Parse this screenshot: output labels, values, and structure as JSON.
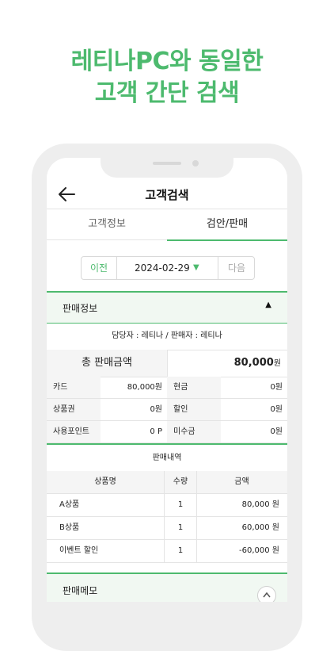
{
  "headline": {
    "line1": "레티나PC와 동일한",
    "line2": "고객 간단 검색"
  },
  "appbar": {
    "title": "고객검색"
  },
  "tabs": [
    {
      "label": "고객정보"
    },
    {
      "label": "검안/판매"
    }
  ],
  "date_nav": {
    "prev_label": "이전",
    "date": "2024-02-29",
    "next_label": "다음"
  },
  "sales_info": {
    "title": "판매정보",
    "toggle": "▲",
    "staff_line": "담당자 : 레티나 / 판매자 : 레티나",
    "total_label": "총 판매금액",
    "total_value": "80,000",
    "total_unit": "원",
    "rows": [
      {
        "k1": "카드",
        "v1": "80,000원",
        "k2": "현금",
        "v2": "0원"
      },
      {
        "k1": "상품권",
        "v1": "0원",
        "k2": "할인",
        "v2": "0원"
      },
      {
        "k1": "사용포인트",
        "v1": "0 P",
        "k2": "미수금",
        "v2": "0원"
      }
    ]
  },
  "sales_detail": {
    "title": "판매내역",
    "columns": [
      "상품명",
      "수량",
      "금액"
    ],
    "rows": [
      {
        "name": "A상품",
        "qty": "1",
        "amount": "80,000 원"
      },
      {
        "name": "B상품",
        "qty": "1",
        "amount": "60,000 원"
      },
      {
        "name": "이벤트 할인",
        "qty": "1",
        "amount": "-60,000 원"
      }
    ]
  },
  "memo": {
    "title": "판매메모"
  },
  "colors": {
    "accent": "#4dba6e",
    "section_bg": "#f1f8f2"
  }
}
